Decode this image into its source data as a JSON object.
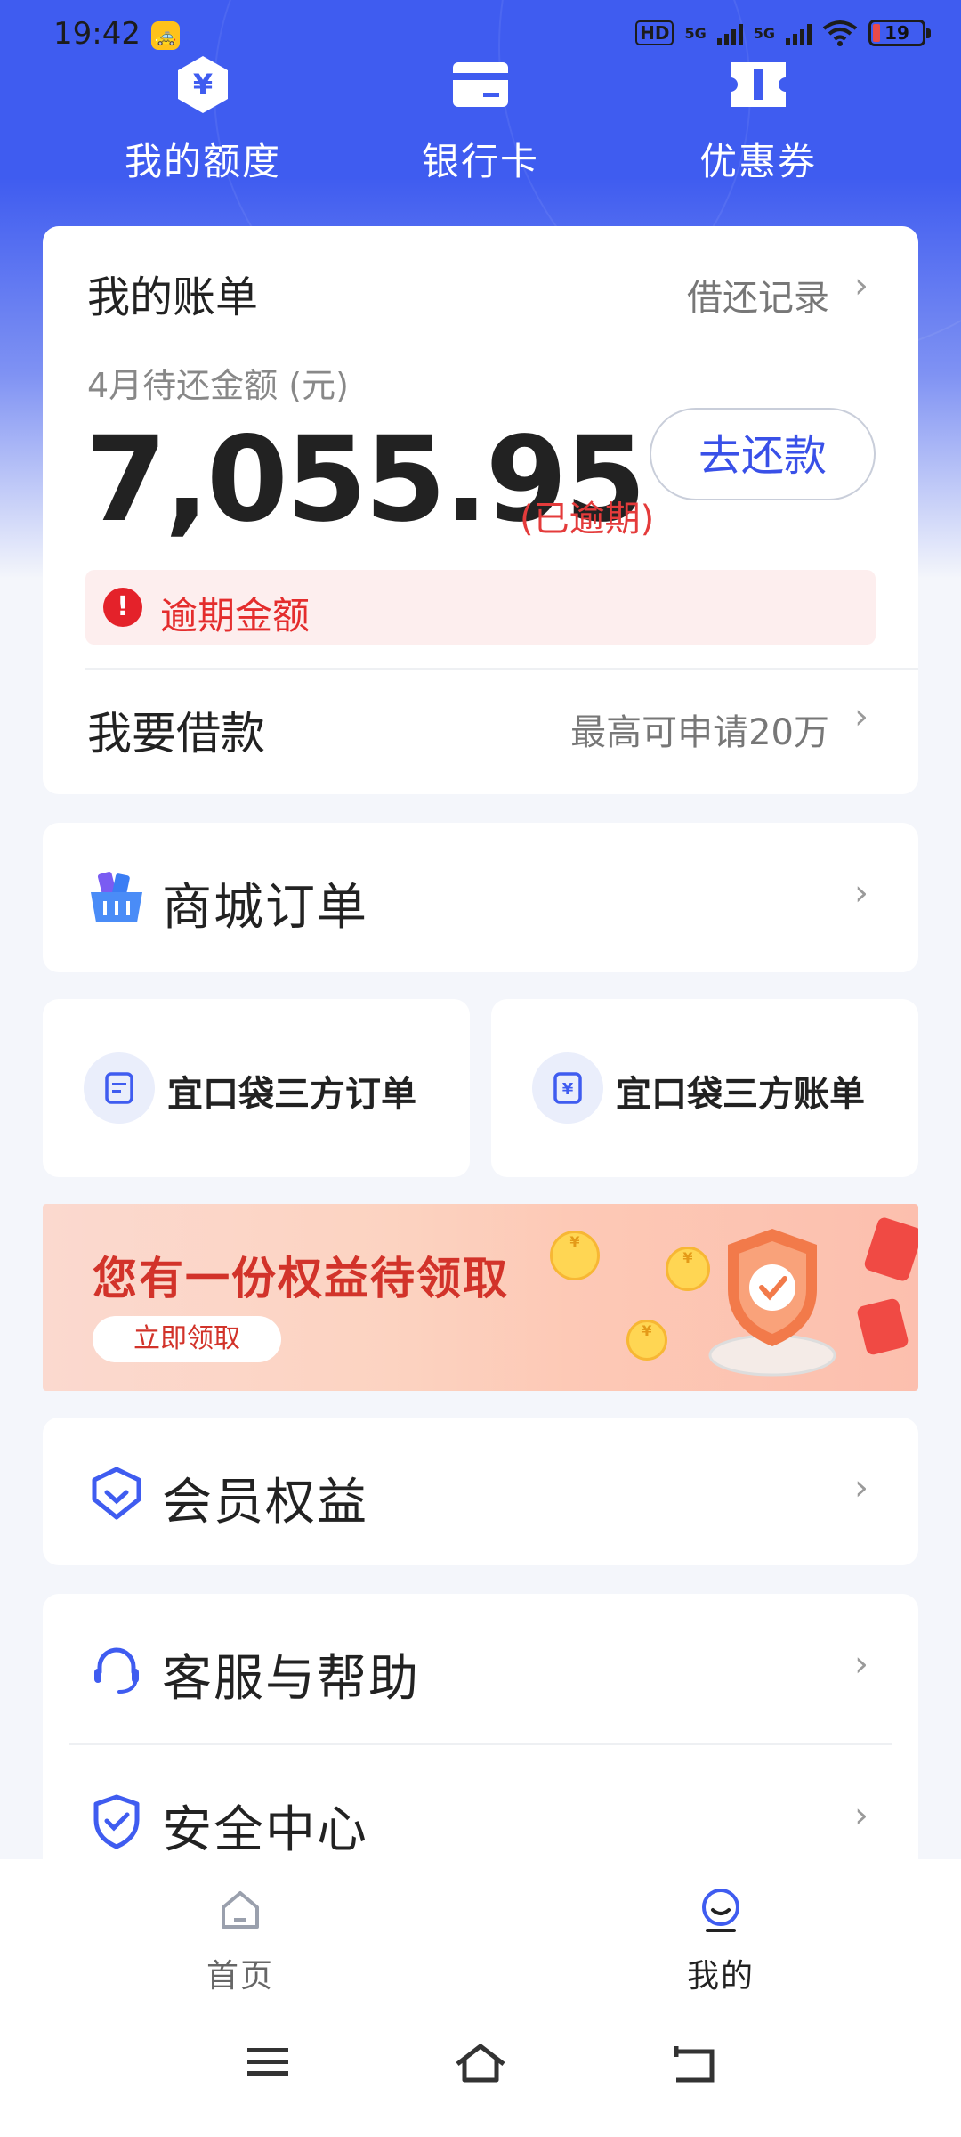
{
  "status_bar": {
    "time": "19:42",
    "hd": "HD",
    "signal_1": "5G",
    "signal_2": "5G",
    "battery": "19"
  },
  "quick_links": [
    {
      "label": "我的额度",
      "icon": "yen-hexagon-icon"
    },
    {
      "label": "银行卡",
      "icon": "bank-card-icon"
    },
    {
      "label": "优惠券",
      "icon": "coupon-icon"
    }
  ],
  "bill": {
    "title": "我的账单",
    "record_link": "借还记录",
    "due_label": "4月待还金额 (元)",
    "amount": "7,055.95",
    "status": "(已逾期)",
    "pay_button": "去还款",
    "alert": "逾期金额",
    "borrow_label": "我要借款",
    "borrow_hint": "最高可申请20万"
  },
  "mall": {
    "label": "商城订单",
    "icon": "shopping-basket-icon"
  },
  "third_party": [
    {
      "label": "宜口袋三方订单",
      "icon": "order-doc-icon"
    },
    {
      "label": "宜口袋三方账单",
      "icon": "yen-bill-icon"
    }
  ],
  "banner": {
    "headline": "您有一份权益待领取",
    "button": "立即领取"
  },
  "member": {
    "label": "会员权益",
    "icon": "member-badge-icon"
  },
  "service": [
    {
      "label": "客服与帮助",
      "icon": "headset-icon"
    },
    {
      "label": "安全中心",
      "icon": "shield-check-icon"
    }
  ],
  "bottom_nav": {
    "home": "首页",
    "mine": "我的",
    "active": "mine"
  },
  "colors": {
    "brand_blue": "#3f5cf0",
    "overdue_red": "#e43b3b"
  }
}
